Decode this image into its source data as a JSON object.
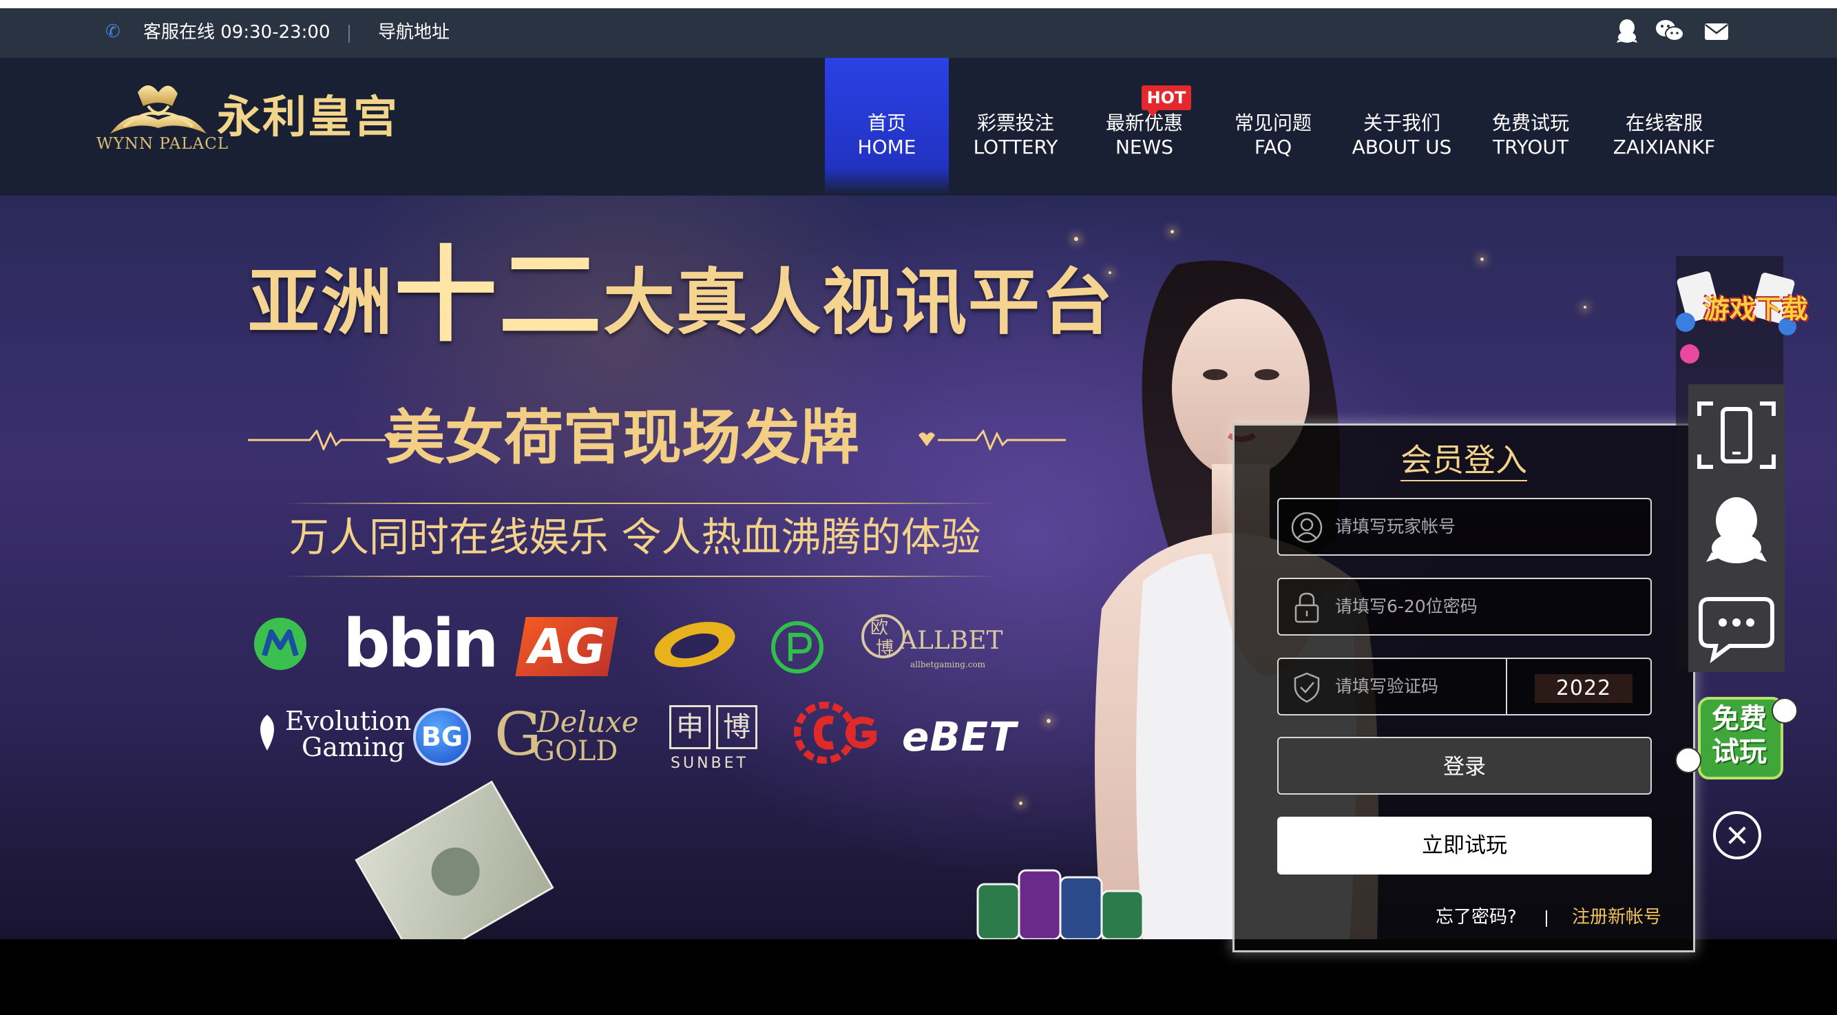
{
  "topbar": {
    "service_text": "客服在线 09:30-23:00",
    "nav_address": "导航地址",
    "icons": [
      "phone-icon",
      "qq-icon",
      "wechat-icon",
      "mail-icon"
    ]
  },
  "logo": {
    "brand_cn": "永利皇宫",
    "brand_en": "WYNN PALACL"
  },
  "nav": {
    "hot_badge": "HOT",
    "items": [
      {
        "cn": "首页",
        "en": "HOME",
        "active": true
      },
      {
        "cn": "彩票投注",
        "en": "LOTTERY"
      },
      {
        "cn": "最新优惠",
        "en": "NEWS"
      },
      {
        "cn": "常见问题",
        "en": "FAQ"
      },
      {
        "cn": "关于我们",
        "en": "ABOUT US"
      },
      {
        "cn": "免费试玩",
        "en": "TRYOUT"
      },
      {
        "cn": "在线客服",
        "en": "ZAIXIANKF"
      }
    ]
  },
  "banner": {
    "headline_pre": "亚洲",
    "headline_big": "十二",
    "headline_post": "大真人视讯平台",
    "subheadline": "美女荷官现场发牌",
    "tagline": "万人同时在线娱乐 令人热血沸腾的体验",
    "partners": [
      "bbin",
      "AG",
      "ALLBET",
      "allbetgaming.com",
      "Evolution",
      "Gaming",
      "BG",
      "Deluxe",
      "GOLD",
      "申",
      "博",
      "SUNBET",
      "eBET"
    ]
  },
  "login": {
    "title": "会员登入",
    "username_placeholder": "请填写玩家帐号",
    "password_placeholder": "请填写6-20位密码",
    "captcha_placeholder": "请填写验证码",
    "captcha_code": "2022",
    "login_button": "登录",
    "try_button": "立即试玩",
    "forgot": "忘了密码?",
    "register": "注册新帐号"
  },
  "sidebar": {
    "game_download": "游戏下载",
    "free_trial_1": "免费",
    "free_trial_2": "试玩",
    "tools": [
      "mobile-scan-icon",
      "qq-icon",
      "chat-icon"
    ]
  },
  "colors": {
    "topbar_bg": "#2a3342",
    "header_bg": "#1a2033",
    "nav_active": "#2a42e4",
    "hot_red": "#e3282e",
    "gold": "#f3d28b",
    "register_gold": "#f3c25a"
  }
}
